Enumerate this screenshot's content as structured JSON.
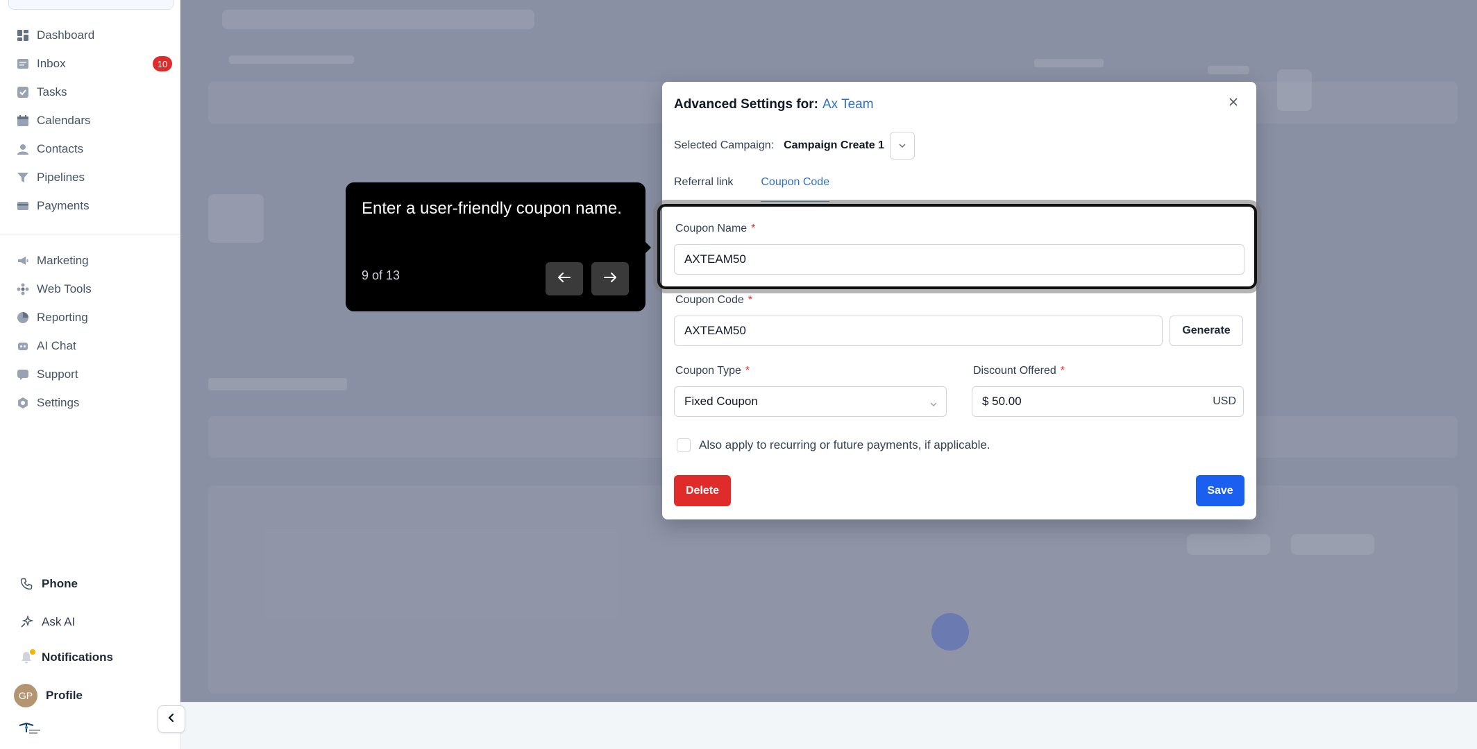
{
  "sidebar": {
    "nav": [
      {
        "label": "Dashboard",
        "icon": "dashboard-icon"
      },
      {
        "label": "Inbox",
        "icon": "inbox-icon",
        "badge": "10"
      },
      {
        "label": "Tasks",
        "icon": "tasks-icon"
      },
      {
        "label": "Calendars",
        "icon": "calendar-icon"
      },
      {
        "label": "Contacts",
        "icon": "contacts-icon"
      },
      {
        "label": "Pipelines",
        "icon": "pipelines-icon"
      },
      {
        "label": "Payments",
        "icon": "payments-icon"
      },
      {
        "label": "Marketing",
        "icon": "marketing-icon"
      },
      {
        "label": "Web Tools",
        "icon": "web-tools-icon"
      },
      {
        "label": "Reporting",
        "icon": "reporting-icon"
      },
      {
        "label": "AI Chat",
        "icon": "ai-chat-icon"
      },
      {
        "label": "Support",
        "icon": "support-icon"
      },
      {
        "label": "Settings",
        "icon": "settings-icon"
      }
    ],
    "bottom": {
      "phone": "Phone",
      "ask_ai": "Ask AI",
      "notifications": "Notifications",
      "profile": "Profile",
      "avatar_initials": "GP"
    }
  },
  "modal": {
    "title": "Advanced Settings for:",
    "team": "Ax Team",
    "campaign_label": "Selected Campaign:",
    "campaign_value": "Campaign Create 1",
    "tabs": [
      {
        "label": "Referral link",
        "active": false
      },
      {
        "label": "Coupon Code",
        "active": true
      }
    ],
    "coupon_name": {
      "label": "Coupon Name",
      "value": "AXTEAM50"
    },
    "coupon_code": {
      "label": "Coupon Code",
      "value": "AXTEAM50",
      "generate": "Generate"
    },
    "coupon_type": {
      "label": "Coupon Type",
      "value": "Fixed Coupon"
    },
    "discount": {
      "label": "Discount Offered",
      "value": "$ 50.00",
      "currency": "USD"
    },
    "required_mark": "*",
    "recurring_label": "Also apply to recurring or future payments, if applicable.",
    "delete": "Delete",
    "save": "Save"
  },
  "tour": {
    "text": "Enter a user-friendly coupon name.",
    "step": "9 of 13"
  },
  "colors": {
    "accent": "#2f6fc6",
    "primary_button": "#1b5ff0",
    "danger": "#e02b2b",
    "overlay": "#8a90a3"
  }
}
